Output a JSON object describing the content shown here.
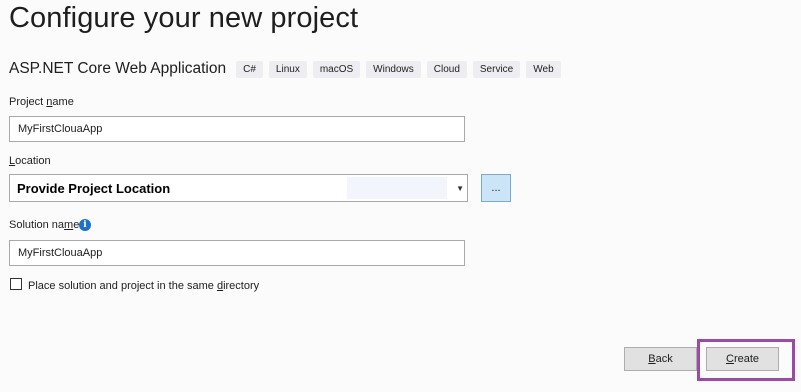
{
  "header": {
    "title": "Configure your new project"
  },
  "template": {
    "name": "ASP.NET Core Web Application",
    "tags": [
      "C#",
      "Linux",
      "macOS",
      "Windows",
      "Cloud",
      "Service",
      "Web"
    ]
  },
  "project_name": {
    "label_pre": "Project ",
    "label_key": "n",
    "label_post": "ame",
    "value": "MyFirstClouaApp"
  },
  "location": {
    "label_key": "L",
    "label_post": "ocation",
    "value": "Provide Project Location",
    "browse_label": "..."
  },
  "solution_name": {
    "label_pre": "Solution na",
    "label_key": "m",
    "label_post": "e",
    "value": "MyFirstClouaApp",
    "info_glyph": "i"
  },
  "checkbox": {
    "label_pre": "Place solution and project in the same ",
    "label_key": "d",
    "label_post": "irectory",
    "checked": false
  },
  "footer": {
    "back_key": "B",
    "back_post": "ack",
    "create_key": "C",
    "create_post": "reate"
  },
  "colors": {
    "highlight": "#9b4ba6",
    "info": "#1a73c8",
    "browse_bg": "#cce4f7"
  }
}
